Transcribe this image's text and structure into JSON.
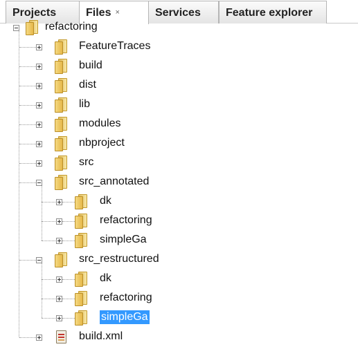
{
  "tabs": [
    {
      "label": "Projects"
    },
    {
      "label": "Files",
      "close_glyph": "×"
    },
    {
      "label": "Services"
    },
    {
      "label": "Feature explorer"
    }
  ],
  "active_tab": "Files",
  "tree": {
    "root": {
      "label": "refactoring",
      "expanded": true
    },
    "items": [
      {
        "label": "FeatureTraces"
      },
      {
        "label": "build"
      },
      {
        "label": "dist"
      },
      {
        "label": "lib"
      },
      {
        "label": "modules"
      },
      {
        "label": "nbproject"
      },
      {
        "label": "src"
      },
      {
        "label": "src_annotated",
        "expanded": true,
        "children": [
          {
            "label": "dk"
          },
          {
            "label": "refactoring"
          },
          {
            "label": "simpleGa"
          }
        ]
      },
      {
        "label": "src_restructured",
        "expanded": true,
        "children": [
          {
            "label": "dk"
          },
          {
            "label": "refactoring"
          },
          {
            "label": "simpleGa",
            "selected": true
          }
        ]
      },
      {
        "label": "build.xml",
        "type": "file"
      }
    ]
  },
  "colors": {
    "selection": "#3399ff",
    "folder": "#e6b84a"
  },
  "icons": {
    "folder": "folder-icon",
    "file": "xml-file-icon",
    "close": "close-icon"
  }
}
